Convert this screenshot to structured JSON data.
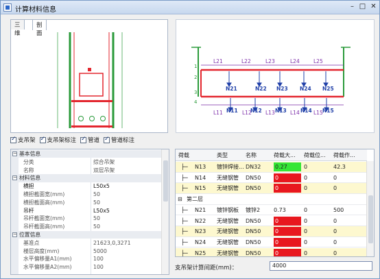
{
  "window": {
    "title": "计算材料信息",
    "btn_min": "–",
    "btn_max": "□",
    "btn_close": "✕"
  },
  "tabs": [
    "三维",
    "剖面"
  ],
  "checkboxes": [
    "支吊架",
    "支吊架标注",
    "管道",
    "管道标注"
  ],
  "diagram": {
    "spans_top": [
      "L21",
      "L22",
      "L23",
      "L24",
      "L25"
    ],
    "spans_bottom": [
      "L11",
      "L12",
      "L13",
      "L14",
      "L15"
    ],
    "loads_top": [
      "N21",
      "N22",
      "N23",
      "N24",
      "N25"
    ],
    "loads_bottom": [
      "N11",
      "N12",
      "N13",
      "N14",
      "N15"
    ],
    "node_numbers": [
      "1",
      "2",
      "3",
      "4"
    ]
  },
  "properties": [
    {
      "group": true,
      "key": "基本信息"
    },
    {
      "key": "分类",
      "value": "综合吊架"
    },
    {
      "key": "名称",
      "value": "双层吊架"
    },
    {
      "group": true,
      "key": "材料信息"
    },
    {
      "key": "横担",
      "value": "L50x5",
      "dark": true
    },
    {
      "key": "横担截面宽(mm)",
      "value": "50"
    },
    {
      "key": "横担截面高(mm)",
      "value": "50"
    },
    {
      "key": "吊杆",
      "value": "L50x5",
      "dark": true
    },
    {
      "key": "吊杆截面宽(mm)",
      "value": "50"
    },
    {
      "key": "吊杆截面高(mm)",
      "value": "50"
    },
    {
      "group": true,
      "key": "位置信息"
    },
    {
      "key": "基准点",
      "value": "21623,0,3271"
    },
    {
      "key": "楼层高度(mm)",
      "value": "5000"
    },
    {
      "key": "水平偏移量A1(mm)",
      "value": "100"
    },
    {
      "key": "水平偏移量A2(mm)",
      "value": "100"
    }
  ],
  "table": {
    "headers": [
      "荷载",
      "类型",
      "名称",
      "荷载大...",
      "荷载位...",
      "荷载作..."
    ],
    "rows": [
      {
        "id": "N13",
        "type": "镀锌焊接...",
        "name": "DN32",
        "load": "0.27",
        "pos": "0",
        "act": "42.3",
        "hl": true,
        "color": "green"
      },
      {
        "id": "N14",
        "type": "无缝钢管",
        "name": "DN50",
        "load": "0",
        "pos": "0",
        "act": "0",
        "color": "red"
      },
      {
        "id": "N15",
        "type": "无缝钢管",
        "name": "DN50",
        "load": "0",
        "pos": "0",
        "act": "0",
        "hl": true,
        "color": "red"
      },
      {
        "group": "第二层"
      },
      {
        "id": "N21",
        "type": "镀锌钢板",
        "name": "镀锌2",
        "load": "0.73",
        "pos": "0",
        "act": "500"
      },
      {
        "id": "N22",
        "type": "无缝钢管",
        "name": "DN50",
        "load": "0",
        "pos": "0",
        "act": "0",
        "color": "red"
      },
      {
        "id": "N23",
        "type": "无缝钢管",
        "name": "DN50",
        "load": "0",
        "pos": "0",
        "act": "0",
        "hl": true,
        "color": "red"
      },
      {
        "id": "N24",
        "type": "无缝钢管",
        "name": "DN50",
        "load": "0",
        "pos": "0",
        "act": "0",
        "color": "red"
      },
      {
        "id": "N25",
        "type": "无缝钢管",
        "name": "DN50",
        "load": "0",
        "pos": "0",
        "act": "0",
        "hl": true,
        "color": "red"
      }
    ]
  },
  "spacing": {
    "label": "支吊架计算间距(mm)：",
    "value": "4000"
  },
  "colors": {
    "load_red": "#e8171e",
    "load_green": "#35e636",
    "row_highlight": "#fdf8cf",
    "structure": "#e3262e",
    "rods": "#2a9a3a"
  }
}
